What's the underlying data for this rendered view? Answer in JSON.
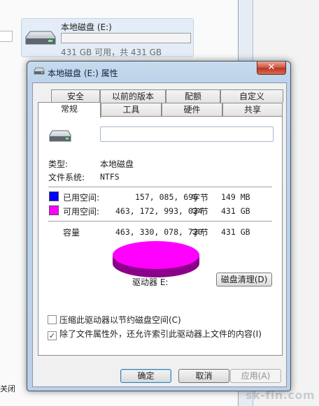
{
  "explorer": {
    "drive_name": "本地磁盘 (E:)",
    "drive_free_text": "431 GB 可用，共 431 GB",
    "close_label": "关闭"
  },
  "watermark": "sk-fin.com",
  "dialog": {
    "title": "本地磁盘 (E:) 属性",
    "close_glyph": "✕",
    "tabs_row1": [
      "安全",
      "以前的版本",
      "配额",
      "自定义"
    ],
    "tabs_row2": [
      "常规",
      "工具",
      "硬件",
      "共享"
    ],
    "active_tab": "常规",
    "volume_label_value": "",
    "type_label": "类型:",
    "type_value": "本地磁盘",
    "fs_label": "文件系统:",
    "fs_value": "NTFS",
    "used": {
      "label": "已用空间:",
      "bytes": "157, 085, 696",
      "unit": "字节",
      "size": "149 MB",
      "color": "#0000ff"
    },
    "free": {
      "label": "可用空间:",
      "bytes": "463, 172, 993, 024",
      "unit": "字节",
      "size": "431 GB",
      "color": "#ff00ff"
    },
    "capacity": {
      "label": "容量",
      "bytes": "463, 330, 078, 720",
      "unit": "字节",
      "size": "431 GB"
    },
    "drive_caption": "驱动器 E:",
    "cleanup_button": "磁盘清理(D)",
    "compress_label": "压缩此驱动器以节约磁盘空间(C)",
    "compress_checked": false,
    "index_label": "除了文件属性外，还允许索引此驱动器上文件的内容(I)",
    "index_checked": true,
    "check_glyph": "✓",
    "ok_button": "确定",
    "cancel_button": "取消",
    "apply_button": "应用(A)",
    "pie_used_fraction": 0.0003
  }
}
